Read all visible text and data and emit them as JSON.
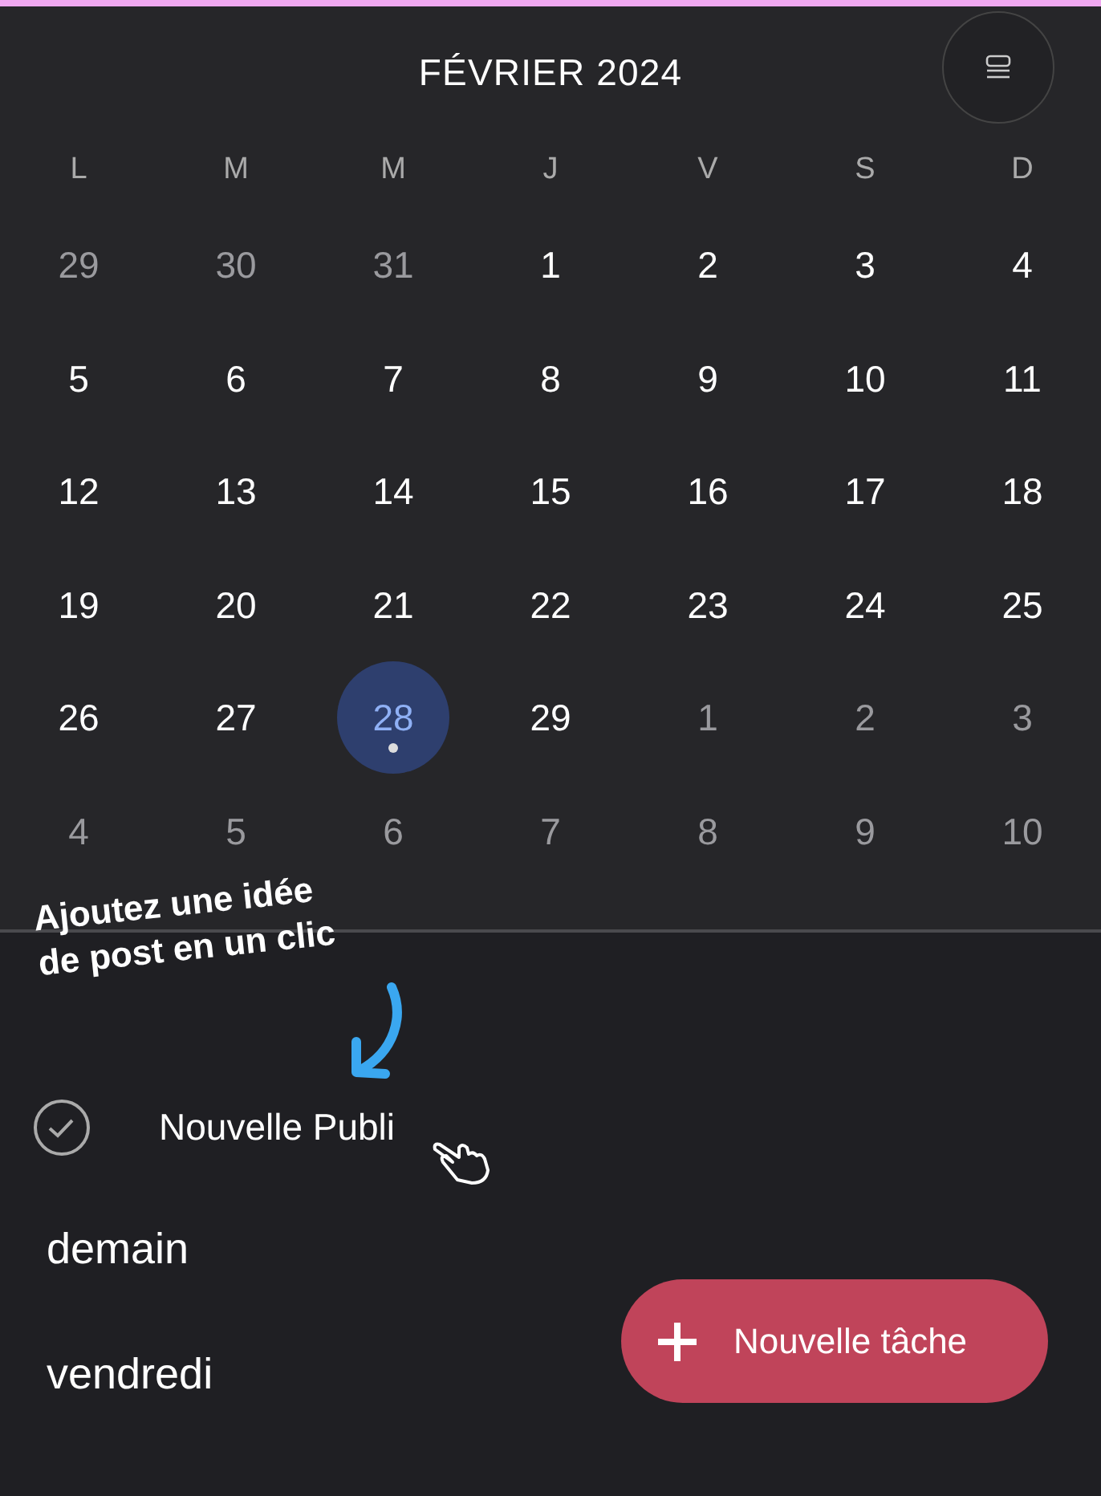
{
  "calendar": {
    "title": "FÉVRIER 2024",
    "weekdays": [
      "L",
      "M",
      "M",
      "J",
      "V",
      "S",
      "D"
    ],
    "days": [
      {
        "label": "29",
        "outside": true,
        "selected": false,
        "dot": false
      },
      {
        "label": "30",
        "outside": true,
        "selected": false,
        "dot": false
      },
      {
        "label": "31",
        "outside": true,
        "selected": false,
        "dot": false
      },
      {
        "label": "1",
        "outside": false,
        "selected": false,
        "dot": false
      },
      {
        "label": "2",
        "outside": false,
        "selected": false,
        "dot": false
      },
      {
        "label": "3",
        "outside": false,
        "selected": false,
        "dot": false
      },
      {
        "label": "4",
        "outside": false,
        "selected": false,
        "dot": false
      },
      {
        "label": "5",
        "outside": false,
        "selected": false,
        "dot": false
      },
      {
        "label": "6",
        "outside": false,
        "selected": false,
        "dot": false
      },
      {
        "label": "7",
        "outside": false,
        "selected": false,
        "dot": false
      },
      {
        "label": "8",
        "outside": false,
        "selected": false,
        "dot": false
      },
      {
        "label": "9",
        "outside": false,
        "selected": false,
        "dot": false
      },
      {
        "label": "10",
        "outside": false,
        "selected": false,
        "dot": false
      },
      {
        "label": "11",
        "outside": false,
        "selected": false,
        "dot": false
      },
      {
        "label": "12",
        "outside": false,
        "selected": false,
        "dot": false
      },
      {
        "label": "13",
        "outside": false,
        "selected": false,
        "dot": false
      },
      {
        "label": "14",
        "outside": false,
        "selected": false,
        "dot": false
      },
      {
        "label": "15",
        "outside": false,
        "selected": false,
        "dot": false
      },
      {
        "label": "16",
        "outside": false,
        "selected": false,
        "dot": false
      },
      {
        "label": "17",
        "outside": false,
        "selected": false,
        "dot": false
      },
      {
        "label": "18",
        "outside": false,
        "selected": false,
        "dot": false
      },
      {
        "label": "19",
        "outside": false,
        "selected": false,
        "dot": false
      },
      {
        "label": "20",
        "outside": false,
        "selected": false,
        "dot": false
      },
      {
        "label": "21",
        "outside": false,
        "selected": false,
        "dot": false
      },
      {
        "label": "22",
        "outside": false,
        "selected": false,
        "dot": false
      },
      {
        "label": "23",
        "outside": false,
        "selected": false,
        "dot": false
      },
      {
        "label": "24",
        "outside": false,
        "selected": false,
        "dot": false
      },
      {
        "label": "25",
        "outside": false,
        "selected": false,
        "dot": false
      },
      {
        "label": "26",
        "outside": false,
        "selected": false,
        "dot": false
      },
      {
        "label": "27",
        "outside": false,
        "selected": false,
        "dot": false
      },
      {
        "label": "28",
        "outside": false,
        "selected": true,
        "dot": true
      },
      {
        "label": "29",
        "outside": false,
        "selected": false,
        "dot": false
      },
      {
        "label": "1",
        "outside": true,
        "selected": false,
        "dot": false
      },
      {
        "label": "2",
        "outside": true,
        "selected": false,
        "dot": false
      },
      {
        "label": "3",
        "outside": true,
        "selected": false,
        "dot": false
      },
      {
        "label": "4",
        "outside": true,
        "selected": false,
        "dot": false
      },
      {
        "label": "5",
        "outside": true,
        "selected": false,
        "dot": false
      },
      {
        "label": "6",
        "outside": true,
        "selected": false,
        "dot": false
      },
      {
        "label": "7",
        "outside": true,
        "selected": false,
        "dot": false
      },
      {
        "label": "8",
        "outside": true,
        "selected": false,
        "dot": false
      },
      {
        "label": "9",
        "outside": true,
        "selected": false,
        "dot": false
      },
      {
        "label": "10",
        "outside": true,
        "selected": false,
        "dot": false
      }
    ]
  },
  "annotation": {
    "lines": [
      "Ajoutez une idée",
      "de post en un clic"
    ]
  },
  "tasks": [
    {
      "title": "Nouvelle Publi"
    }
  ],
  "sections": [
    "demain",
    "vendredi"
  ],
  "fab": {
    "label": "Nouvelle tâche"
  }
}
